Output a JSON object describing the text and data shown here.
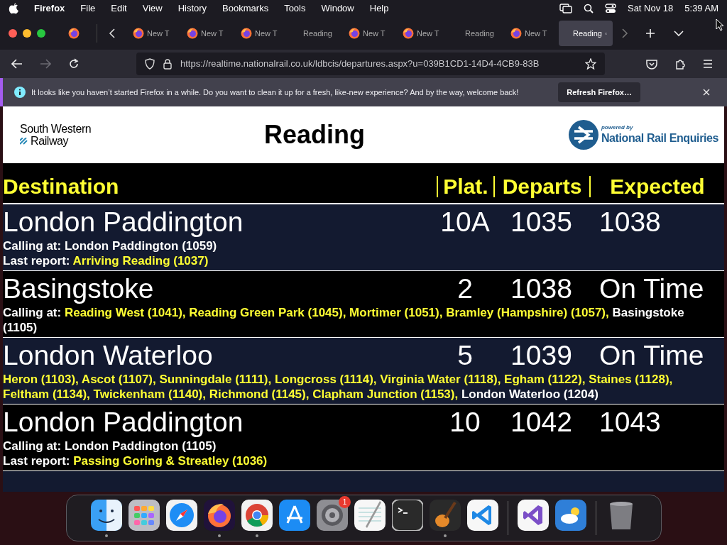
{
  "menu_bar": {
    "app": "Firefox",
    "items": [
      "File",
      "Edit",
      "View",
      "History",
      "Bookmarks",
      "Tools",
      "Window",
      "Help"
    ],
    "date": "Sat Nov 18",
    "time": "5:39 AM"
  },
  "tabs": [
    {
      "kind": "newtab",
      "label": "New T",
      "selected": false
    },
    {
      "kind": "newtab",
      "label": "New T",
      "selected": false
    },
    {
      "kind": "newtab",
      "label": "New T",
      "selected": false
    },
    {
      "kind": "page",
      "label": "Reading",
      "selected": false
    },
    {
      "kind": "newtab",
      "label": "New T",
      "selected": false
    },
    {
      "kind": "newtab",
      "label": "New T",
      "selected": false
    },
    {
      "kind": "page",
      "label": "Reading",
      "selected": false
    },
    {
      "kind": "newtab",
      "label": "New T",
      "selected": false
    },
    {
      "kind": "page",
      "label": "Reading",
      "selected": true
    }
  ],
  "address_bar": {
    "url": "https://realtime.nationalrail.co.uk/ldbcis/departures.aspx?u=039B1CD1-14D4-4CB9-83B",
    "forward_disabled": true
  },
  "notification": {
    "message": "It looks like you haven’t started Firefox in a while. Do you want to clean it up for a fresh, like-new experience? And by the way, welcome back!",
    "button": "Refresh Firefox…"
  },
  "header": {
    "operator_logo": [
      "South Western",
      "Railway"
    ],
    "station": "Reading",
    "powered_by": "powered by",
    "nre_logo": "National Rail Enquiries"
  },
  "board": {
    "columns": [
      "Destination",
      "Plat.",
      "Departs",
      "Expected"
    ],
    "rows": [
      {
        "destination": "London Paddington",
        "platform": "10A",
        "departs": "1035",
        "expected": "1038",
        "calling_at": {
          "label": "Calling at:",
          "final": "London Paddington (1059)"
        },
        "last_report": {
          "label": "Last report:",
          "text": "Arriving Reading (1037)"
        }
      },
      {
        "destination": "Basingstoke",
        "platform": "2",
        "departs": "1038",
        "expected": "On Time",
        "calling_at": {
          "label": "Calling at:",
          "stops": "Reading West (1041), Reading Green Park (1045), Mortimer (1051), Bramley (Hampshire) (1057),",
          "final": "Basingstoke (1105)"
        }
      },
      {
        "destination": "London Waterloo",
        "platform": "5",
        "departs": "1039",
        "expected": "On Time",
        "calling_at": {
          "stops": "Heron (1103), Ascot (1107), Sunningdale (1111), Longcross (1114), Virginia Water (1118), Egham (1122), Staines (1128), Feltham (1134), Twickenham (1140), Richmond (1145), Clapham Junction (1153),",
          "final": "London Waterloo (1204)"
        }
      },
      {
        "destination": "London Paddington",
        "platform": "10",
        "departs": "1042",
        "expected": "1043",
        "calling_at": {
          "label": "Calling at:",
          "final": "London Paddington (1105)"
        },
        "last_report": {
          "label": "Last report:",
          "text": "Passing Goring & Streatley (1036)"
        }
      }
    ]
  },
  "dock": [
    {
      "kind": "finder",
      "running": true
    },
    {
      "kind": "launchpad",
      "running": false
    },
    {
      "kind": "safari",
      "running": false
    },
    {
      "kind": "firefox",
      "running": true
    },
    {
      "kind": "chrome",
      "running": true
    },
    {
      "kind": "appstore",
      "running": false
    },
    {
      "kind": "settings",
      "running": false,
      "badge": "1"
    },
    {
      "kind": "textedit",
      "running": false
    },
    {
      "kind": "terminal",
      "running": false
    },
    {
      "kind": "garageband",
      "running": true
    },
    {
      "kind": "vscode",
      "running": false
    },
    {
      "kind": "separator"
    },
    {
      "kind": "visualstudio",
      "running": false
    },
    {
      "kind": "weather",
      "running": false
    },
    {
      "kind": "separator"
    },
    {
      "kind": "trash",
      "running": false
    }
  ]
}
